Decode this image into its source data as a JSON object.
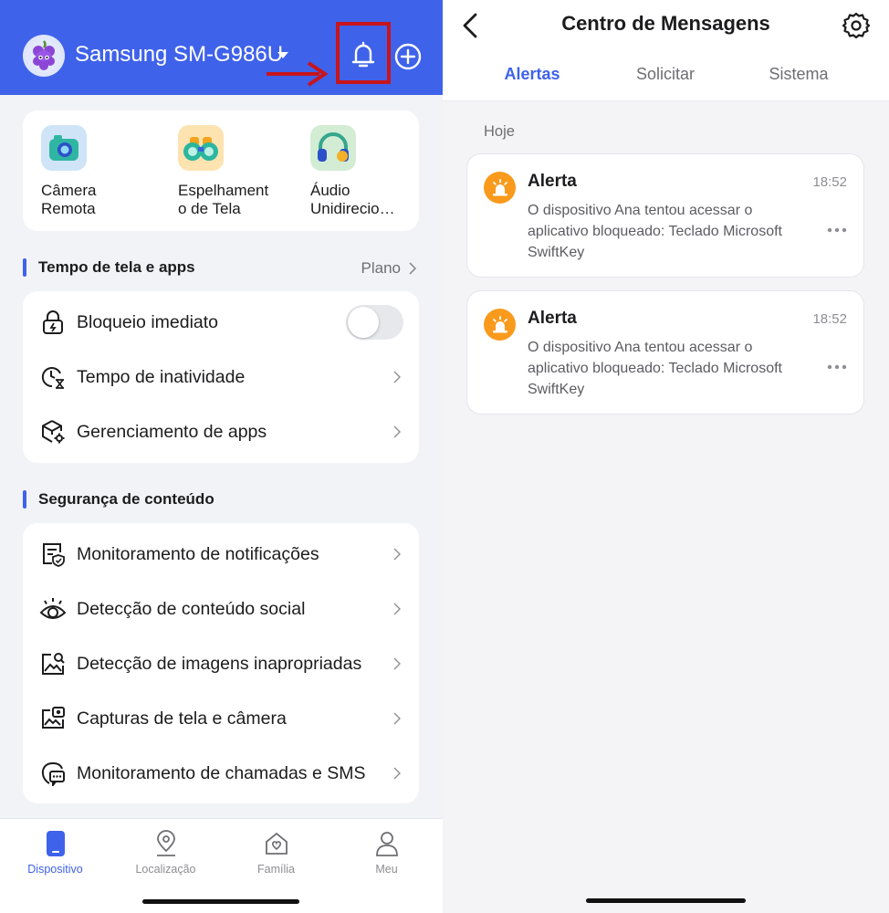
{
  "left": {
    "header": {
      "device_name": "Samsung SM-G986U"
    },
    "quick_actions": [
      {
        "label": "Câmera Remota",
        "icon": "camera-icon"
      },
      {
        "label": "Espelhament o de Tela",
        "icon": "binoculars-icon"
      },
      {
        "label": "Áudio Unidirecio…",
        "icon": "headphones-icon"
      }
    ],
    "screen_time": {
      "title": "Tempo de tela e apps",
      "plan_label": "Plano",
      "items": [
        {
          "label": "Bloqueio imediato",
          "icon": "lock-icon",
          "toggle_on": false
        },
        {
          "label": "Tempo de inatividade",
          "icon": "clock-icon"
        },
        {
          "label": "Gerenciamento de apps",
          "icon": "app-management-icon"
        }
      ]
    },
    "content_safety": {
      "title": "Segurança de conteúdo",
      "items": [
        {
          "label": "Monitoramento de notificações",
          "icon": "notification-shield-icon"
        },
        {
          "label": "Detecção de conteúdo social",
          "icon": "eye-icon"
        },
        {
          "label": "Detecção de imagens inapropriadas",
          "icon": "image-search-icon"
        },
        {
          "label": "Capturas de tela e câmera",
          "icon": "screenshot-icon"
        },
        {
          "label": "Monitoramento de chamadas e SMS",
          "icon": "chat-call-icon"
        }
      ]
    },
    "tabbar": [
      {
        "label": "Dispositivo",
        "icon": "device-icon",
        "active": true
      },
      {
        "label": "Localização",
        "icon": "location-icon",
        "active": false
      },
      {
        "label": "Família",
        "icon": "family-home-icon",
        "active": false
      },
      {
        "label": "Meu",
        "icon": "person-icon",
        "active": false
      }
    ]
  },
  "right": {
    "title": "Centro de Mensagens",
    "tabs": [
      {
        "label": "Alertas",
        "active": true
      },
      {
        "label": "Solicitar",
        "active": false
      },
      {
        "label": "Sistema",
        "active": false
      }
    ],
    "date_group": "Hoje",
    "alerts": [
      {
        "title": "Alerta",
        "time": "18:52",
        "body": "O dispositivo Ana tentou acessar o aplicativo bloqueado: Teclado Microsoft SwiftKey"
      },
      {
        "title": "Alerta",
        "time": "18:52",
        "body": "O dispositivo Ana tentou acessar o aplicativo bloqueado: Teclado Microsoft SwiftKey"
      }
    ]
  },
  "colors": {
    "brand_blue": "#3f62ea",
    "highlight_red": "#c8141b",
    "alert_orange": "#f99a1c"
  }
}
